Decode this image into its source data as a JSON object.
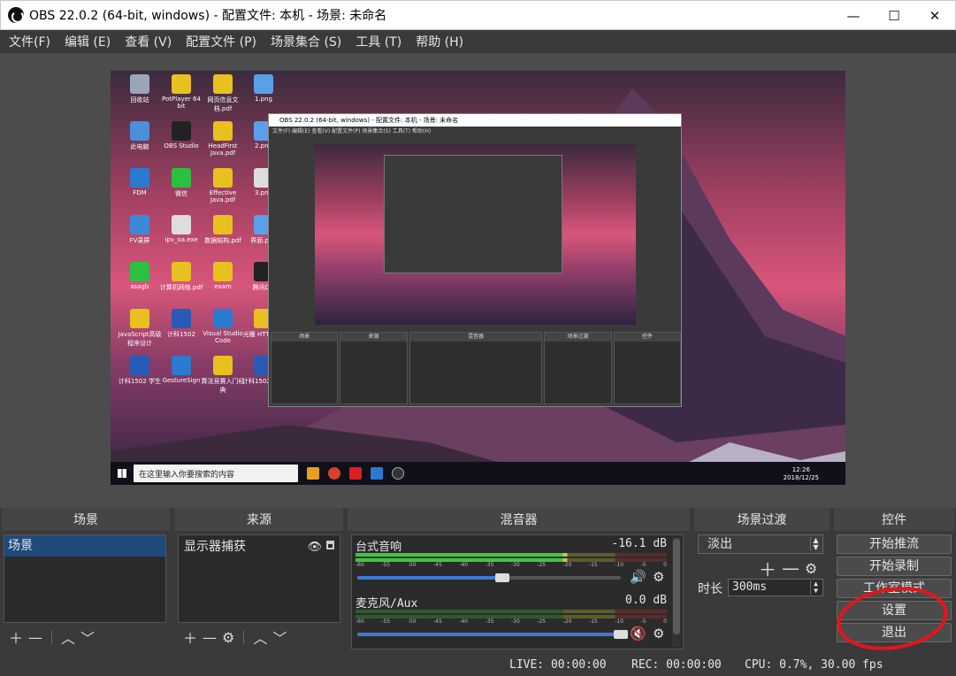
{
  "window": {
    "title": "OBS 22.0.2 (64-bit, windows) - 配置文件: 本机 - 场景: 未命名",
    "minimize_glyph": "—",
    "maximize_glyph": "☐",
    "close_glyph": "✕"
  },
  "menu": [
    "文件(F)",
    "编辑 (E)",
    "查看 (V)",
    "配置文件 (P)",
    "场景集合 (S)",
    "工具 (T)",
    "帮助 (H)"
  ],
  "preview": {
    "desktop_icons": [
      {
        "label": "回收站",
        "color": "#9aa6b8"
      },
      {
        "label": "PotPlayer 64 bit",
        "color": "#e8c020"
      },
      {
        "label": "网页信息文档.pdf",
        "color": "#e8c020"
      },
      {
        "label": "1.png",
        "color": "#5aa0e8"
      },
      {
        "label": "此电脑",
        "color": "#4a90d8"
      },
      {
        "label": "OBS Studio",
        "color": "#222222"
      },
      {
        "label": "HeadFirst Java.pdf",
        "color": "#e8c020"
      },
      {
        "label": "2.png",
        "color": "#5aa0e8"
      },
      {
        "label": "FDM",
        "color": "#2a7ad0"
      },
      {
        "label": "微信",
        "color": "#2cc040"
      },
      {
        "label": "Effective Java.pdf",
        "color": "#e8c020"
      },
      {
        "label": "3.png",
        "color": "#dddddd"
      },
      {
        "label": "FV录屏",
        "color": "#3a8ad8"
      },
      {
        "label": "ipv_oa.exe",
        "color": "#dddddd"
      },
      {
        "label": "数据结构.pdf",
        "color": "#e8c020"
      },
      {
        "label": "界面.png",
        "color": "#5aa0e8"
      },
      {
        "label": "ssagb",
        "color": "#2cc040"
      },
      {
        "label": "计算机网络.pdf",
        "color": "#e8c020"
      },
      {
        "label": "exam",
        "color": "#e8c020"
      },
      {
        "label": "腾讯QQ",
        "color": "#222222"
      },
      {
        "label": "JavaScript高级程序设计",
        "color": "#e8c020"
      },
      {
        "label": "计科1502",
        "color": "#2a5ab8"
      },
      {
        "label": "Visual Studio Code",
        "color": "#2a7ad0"
      },
      {
        "label": "光栅 HTTP.pdf",
        "color": "#e8c020"
      },
      {
        "label": "计科1502 学生",
        "color": "#2a5ab8"
      },
      {
        "label": "GestureSign",
        "color": "#2a7ad0"
      },
      {
        "label": "算法竞赛入门经典",
        "color": "#e8c020"
      },
      {
        "label": "计科1502 成绩",
        "color": "#2a5ab8"
      }
    ],
    "search_placeholder": "在这里输入你要搜索的内容",
    "clock_time": "12:26",
    "clock_date": "2018/12/25",
    "nested_title": "OBS 22.0.2 (64-bit, windows) - 配置文件: 本机 - 场景: 未命名",
    "nested_menu": "文件(F)  编辑(E)  查看(V)  配置文件(P)  场景集合(S)  工具(T)  帮助(H)",
    "nested_docks": [
      "场景",
      "来源",
      "混音器",
      "场景过渡",
      "控件"
    ]
  },
  "docks": {
    "scenes": {
      "header": "场景",
      "items": [
        "场景"
      ]
    },
    "sources": {
      "header": "来源",
      "items": [
        "显示器捕获"
      ]
    },
    "mixer": {
      "header": "混音器",
      "scale": [
        "-60",
        "-55",
        "-50",
        "-45",
        "-40",
        "-35",
        "-30",
        "-25",
        "-20",
        "-15",
        "-10",
        "-5",
        "0"
      ],
      "channels": [
        {
          "name": "台式音响",
          "db": "-16.1 dB",
          "level": 0.68,
          "volume": 0.55,
          "muted": false
        },
        {
          "name": "麦克风/Aux",
          "db": "0.0 dB",
          "level": 0.0,
          "volume": 1.0,
          "muted": true
        }
      ]
    },
    "transitions": {
      "header": "场景过渡",
      "selected": "淡出",
      "duration_label": "时长",
      "duration_value": "300ms"
    },
    "controls": {
      "header": "控件",
      "buttons": [
        "开始推流",
        "开始录制",
        "工作室模式",
        "设置",
        "退出"
      ]
    }
  },
  "status": {
    "live": "LIVE: 00:00:00",
    "rec": "REC: 00:00:00",
    "cpu": "CPU: 0.7%, 30.00 fps"
  },
  "colors": {
    "selection": "#1f4a7a",
    "fader": "#3c7bd6",
    "meter_green": "#3fc83f",
    "meter_yellow": "#c8c83f",
    "meter_red": "#c83f3f",
    "annotation": "#e8131c"
  }
}
